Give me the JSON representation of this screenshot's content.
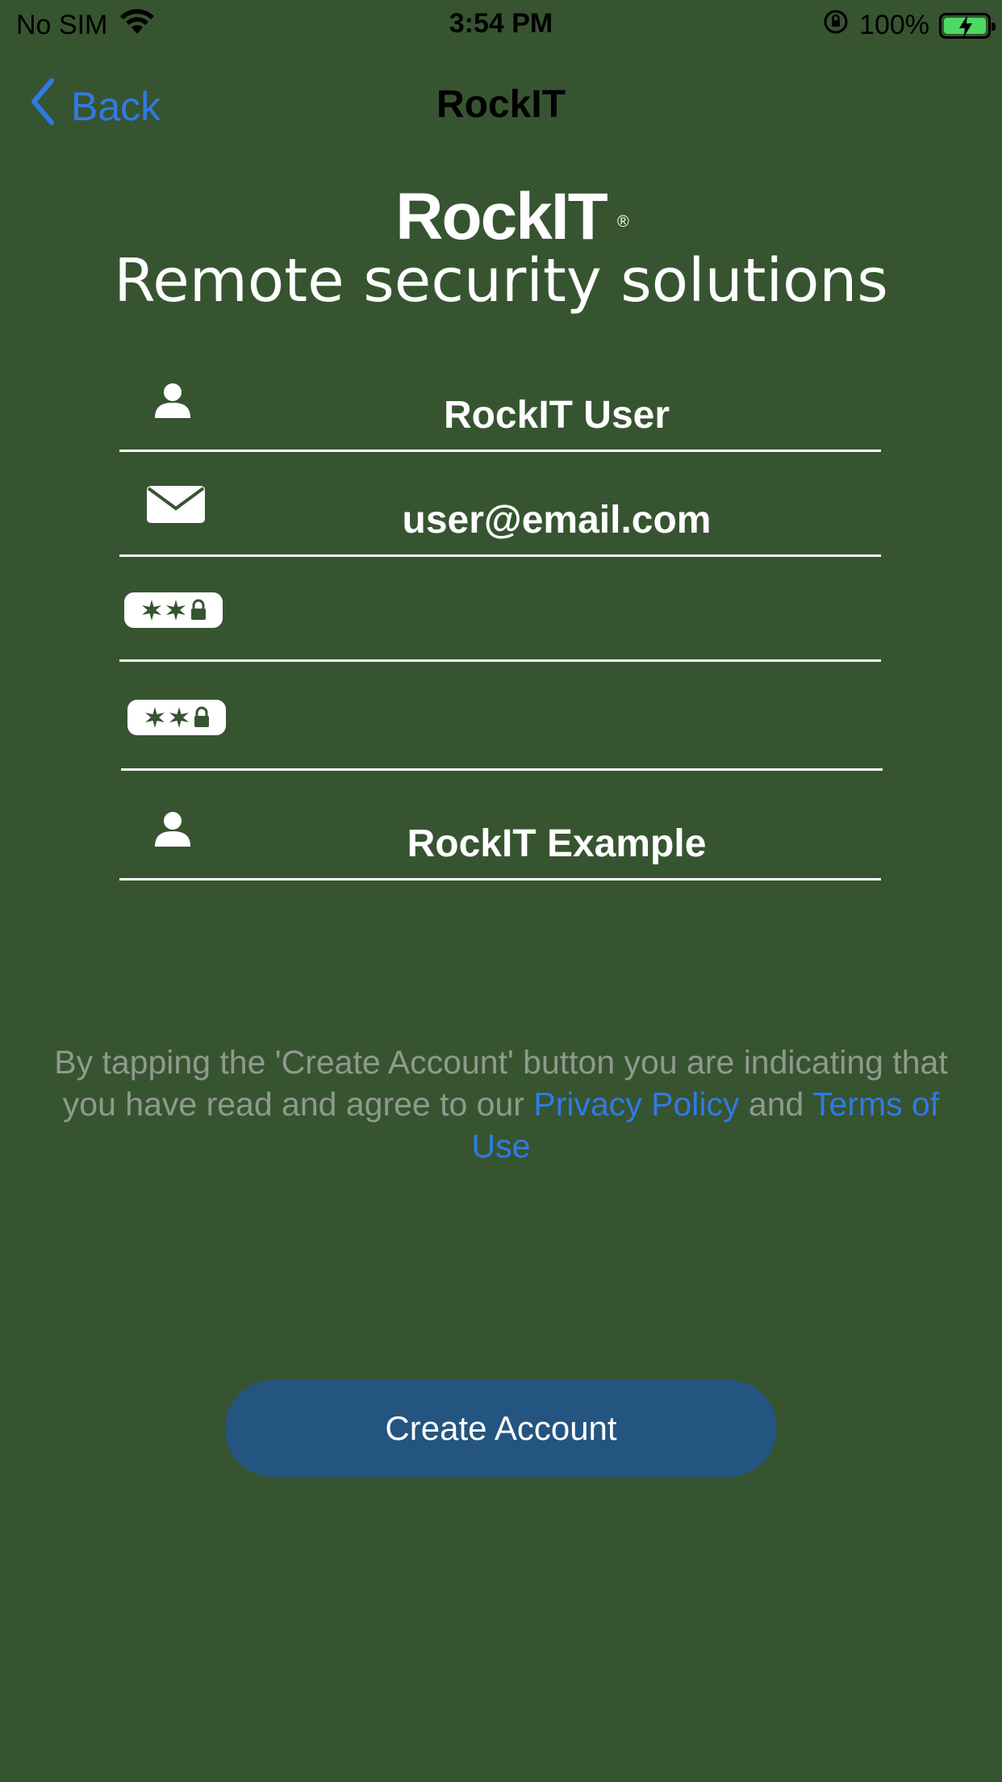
{
  "status_bar": {
    "carrier": "No SIM",
    "time": "3:54 PM",
    "battery": "100%",
    "battery_level": 1.0
  },
  "nav": {
    "back_label": "Back",
    "title": "RockIT"
  },
  "logo": {
    "wordmark": "RockIT",
    "registered": "®",
    "tagline": "Remote security solutions"
  },
  "form": {
    "name": {
      "value": "RockIT User",
      "icon": "person-icon"
    },
    "email": {
      "value": "user@email.com",
      "icon": "envelope-icon"
    },
    "password": {
      "value": "",
      "icon": "password-icon"
    },
    "confirm_password": {
      "value": "",
      "icon": "password-icon"
    },
    "company": {
      "value": "RockIT Example",
      "icon": "person-icon"
    }
  },
  "legal": {
    "prefix": "By tapping the 'Create Account' button you are indicating that you have read and agree to our",
    "privacy_link": "Privacy Policy",
    "connector": "and",
    "terms_link": "Terms of Use"
  },
  "actions": {
    "create_account_label": "Create Account"
  },
  "colors": {
    "background": "#375431",
    "link": "#2f7ae5",
    "button": "#245480",
    "legal_text": "#8f9a8d"
  }
}
